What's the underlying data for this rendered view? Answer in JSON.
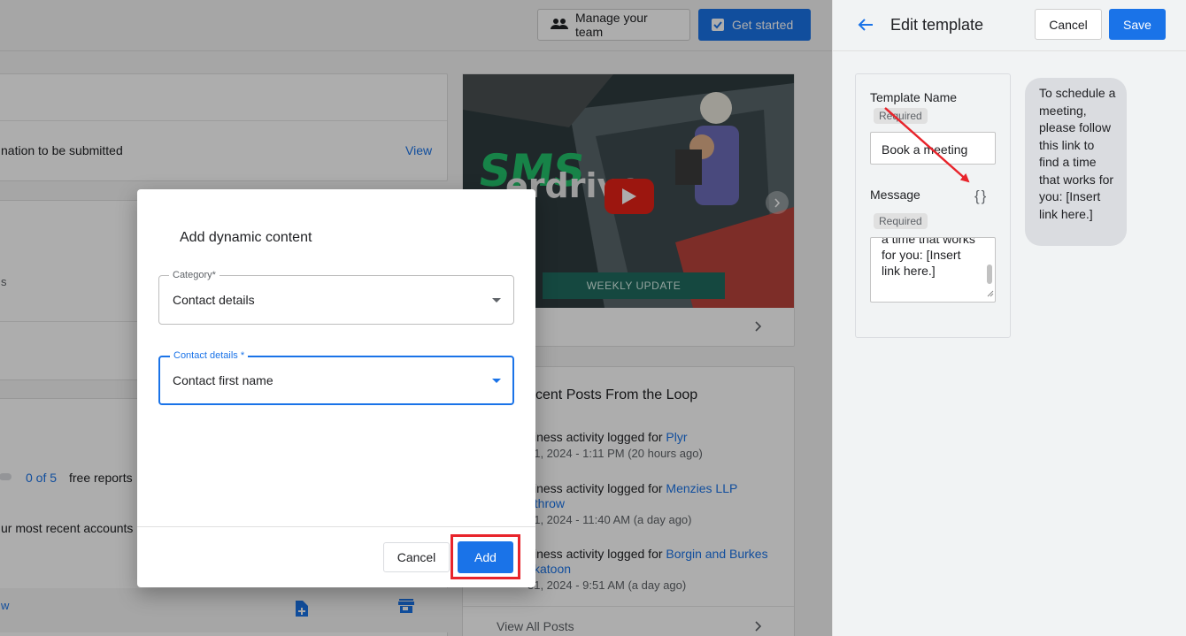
{
  "topbar": {
    "manage_team_label": "Manage your team",
    "get_started_label": "Get started"
  },
  "background": {
    "submitted_text": "nation to be submitted",
    "view_link": "View",
    "side_letter": "s",
    "reports_count": "0 of 5",
    "reports_text": "free reports",
    "recent_accounts_text": "ur most recent accounts",
    "bottom_link_letter": "w",
    "video": {
      "title": "SMS",
      "title_second": "erdrive",
      "banner": "WEEKLY UPDATE"
    },
    "posts_title": "cent Posts From the Loop",
    "posts": [
      {
        "prefix": "siness activity logged for ",
        "link": "Plyr",
        "link2": "",
        "date": "31, 2024 - 1:11 PM (20 hours ago)"
      },
      {
        "prefix": "siness activity logged for ",
        "link": "Menzies LLP",
        "link2": "athrow",
        "date": "31, 2024 - 11:40 AM (a day ago)"
      },
      {
        "prefix": "siness activity logged for ",
        "link": "Borgin and Burkes",
        "link2": "skatoon",
        "date": "31, 2024 - 9:51 AM (a day ago)"
      }
    ],
    "view_all_posts": "View All Posts"
  },
  "dialog": {
    "title": "Add dynamic content",
    "category_label": "Category*",
    "category_value": "Contact details",
    "contact_label": "Contact details *",
    "contact_value": "Contact first name",
    "cancel_label": "Cancel",
    "add_label": "Add"
  },
  "panel": {
    "title": "Edit template",
    "cancel_label": "Cancel",
    "save_label": "Save",
    "template_name_label": "Template Name",
    "required": "Required",
    "template_name_value": "Book a meeting",
    "message_label": "Message",
    "braces": "{}",
    "message_value": "a time that works for you: [Insert link here.]",
    "preview_text": "To schedule a meeting, please follow this link to find a time that works for you: [Insert link here.]"
  },
  "colors": {
    "primary": "#1a73e8",
    "highlight": "#e8242b"
  }
}
